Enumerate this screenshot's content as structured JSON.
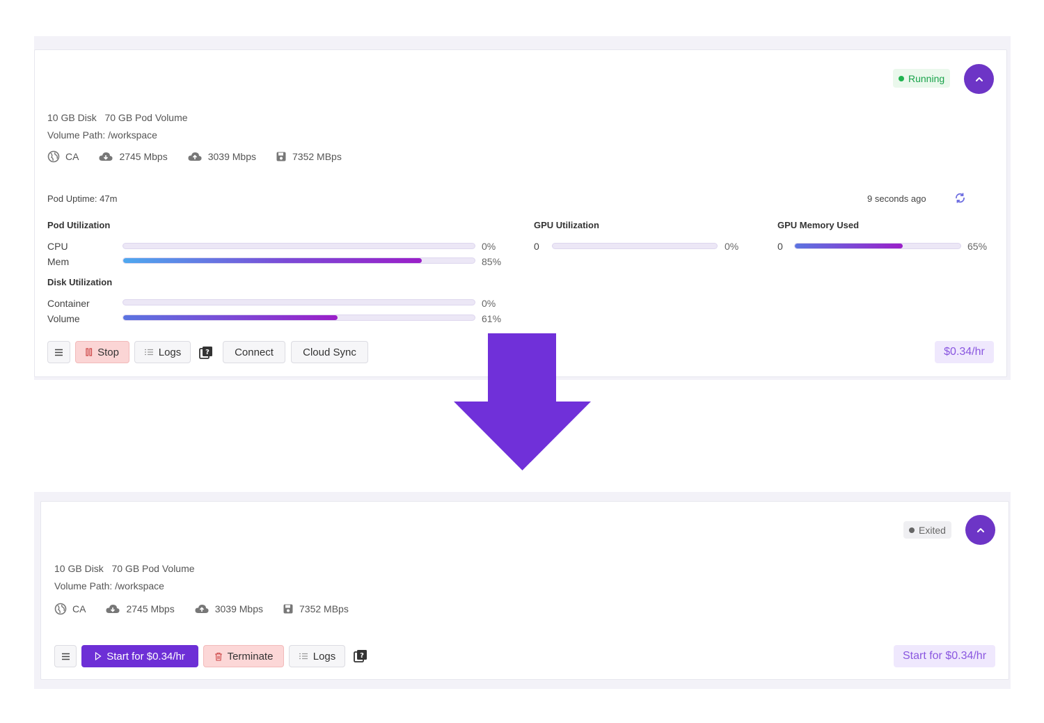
{
  "colors": {
    "accent": "#6d35c6",
    "arrow": "#7030d9",
    "running": "#1fb34f",
    "danger_bg": "#fbd5d5",
    "price_text": "#8a57e0"
  },
  "top_card": {
    "status": "Running",
    "disk_info": "10 GB Disk   70 GB Pod Volume",
    "volume_path": "Volume Path: /workspace",
    "stats": {
      "region": "CA",
      "download": "2745 Mbps",
      "upload": "3039 Mbps",
      "disk_speed": "7352 MBps"
    },
    "uptime": "Pod Uptime: 47m",
    "updated": "9 seconds ago",
    "pod_utilization": {
      "title": "Pod Utilization",
      "cpu": {
        "label": "CPU",
        "pct_text": "0%",
        "value": 0
      },
      "mem": {
        "label": "Mem",
        "pct_text": "85%",
        "value": 85
      }
    },
    "disk_utilization": {
      "title": "Disk Utilization",
      "container": {
        "label": "Container",
        "pct_text": "0%",
        "value": 0
      },
      "volume": {
        "label": "Volume",
        "pct_text": "61%",
        "value": 61
      }
    },
    "gpu_utilization": {
      "title": "GPU Utilization",
      "count": "0",
      "pct_text": "0%",
      "value": 0
    },
    "gpu_memory": {
      "title": "GPU Memory Used",
      "count": "0",
      "pct_text": "65%",
      "value": 65
    },
    "buttons": {
      "stop": "Stop",
      "logs": "Logs",
      "connect": "Connect",
      "cloud_sync": "Cloud Sync"
    },
    "price": "$0.34/hr",
    "icons": [
      "menu-icon",
      "pause-icon",
      "list-icon",
      "help-book-icon",
      "refresh-icon",
      "globe-icon",
      "cloud-download-icon",
      "cloud-upload-icon",
      "disk-icon",
      "chevron-up-icon"
    ]
  },
  "bottom_card": {
    "status": "Exited",
    "disk_info": "10 GB Disk   70 GB Pod Volume",
    "volume_path": "Volume Path: /workspace",
    "stats": {
      "region": "CA",
      "download": "2745 Mbps",
      "upload": "3039 Mbps",
      "disk_speed": "7352 MBps"
    },
    "buttons": {
      "start": "Start for $0.34/hr",
      "terminate": "Terminate",
      "logs": "Logs"
    },
    "price": "Start for $0.34/hr",
    "icons": [
      "menu-icon",
      "play-icon",
      "trash-icon",
      "list-icon",
      "help-book-icon"
    ]
  }
}
